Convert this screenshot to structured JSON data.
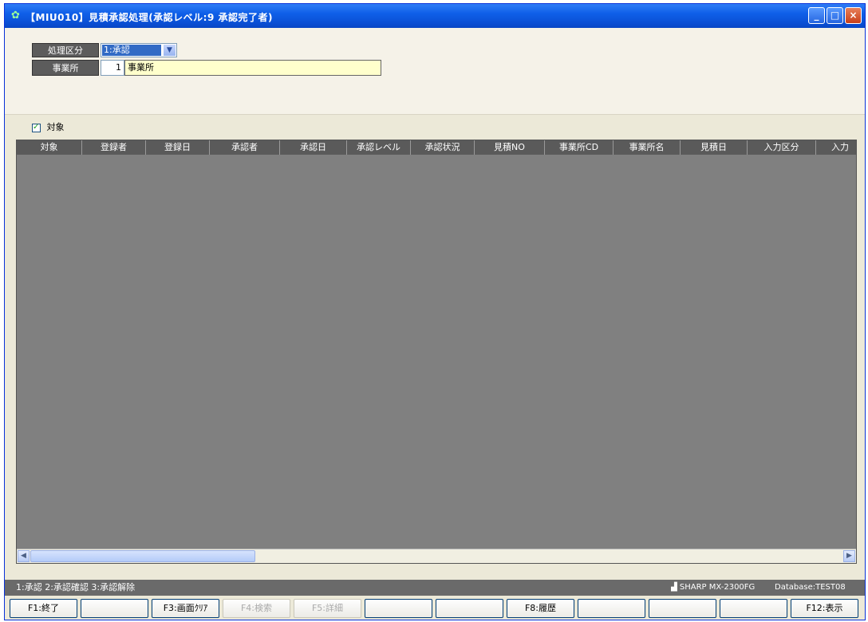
{
  "window": {
    "title": "【MIU010】見積承認処理(承認レベル:9 承認完了者)",
    "minimize": "_",
    "maximize": "□",
    "close": "×"
  },
  "form": {
    "kubun_label": "処理区分",
    "kubun_value": "1:承認",
    "office_label": "事業所",
    "office_code": "1",
    "office_name": "事業所"
  },
  "target_checkbox": {
    "label": "対象",
    "checked": true
  },
  "grid": {
    "columns": [
      "対象",
      "登録者",
      "登録日",
      "承認者",
      "承認日",
      "承認レベル",
      "承認状況",
      "見積NO",
      "事業所CD",
      "事業所名",
      "見積日",
      "入力区分",
      "入力"
    ]
  },
  "status": {
    "left": "1:承認  2:承認確認  3:承認解除",
    "printer": "SHARP MX-2300FG",
    "database": "Database:TEST08"
  },
  "fkeys": [
    {
      "label": "F1:終了",
      "enabled": true
    },
    {
      "label": "",
      "enabled": true
    },
    {
      "label": "F3:画面ｸﾘｱ",
      "enabled": true
    },
    {
      "label": "F4:検索",
      "enabled": false
    },
    {
      "label": "F5:詳細",
      "enabled": false
    },
    {
      "label": "",
      "enabled": true
    },
    {
      "label": "",
      "enabled": true
    },
    {
      "label": "F8:履歴",
      "enabled": true
    },
    {
      "label": "",
      "enabled": true
    },
    {
      "label": "",
      "enabled": true
    },
    {
      "label": "",
      "enabled": true
    },
    {
      "label": "F12:表示",
      "enabled": true
    }
  ]
}
